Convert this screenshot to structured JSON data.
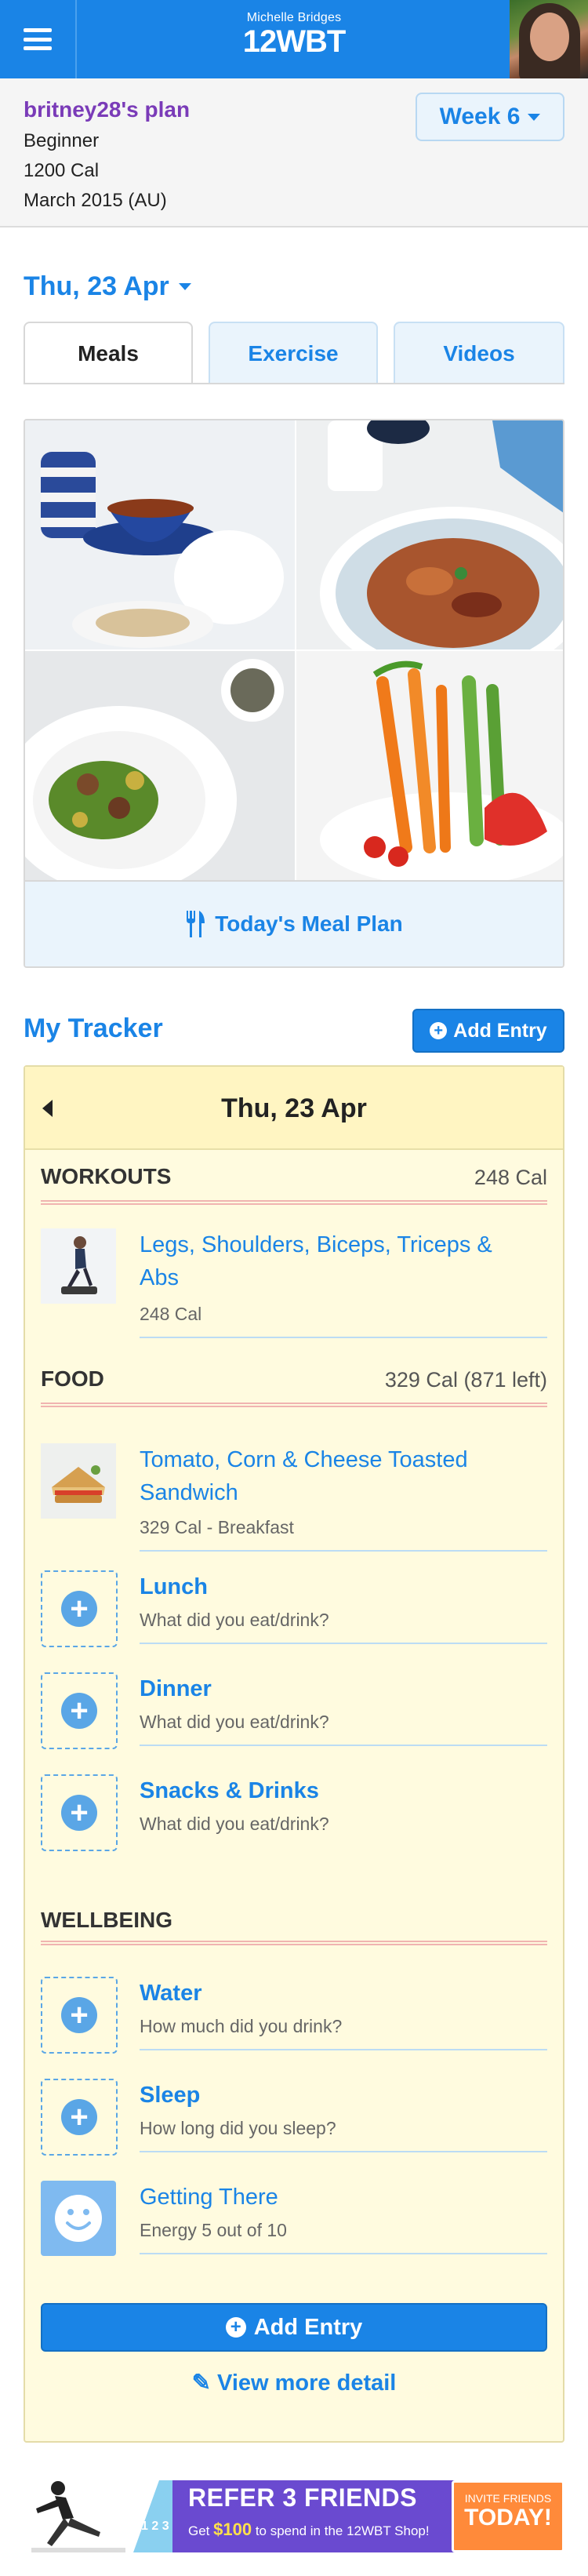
{
  "header": {
    "brand_sub": "Michelle Bridges",
    "brand_main": "12WBT"
  },
  "plan": {
    "name": "britney28's plan",
    "level": "Beginner",
    "calories": "1200 Cal",
    "round": "March 2015 (AU)",
    "week_label": "Week 6"
  },
  "date_selector": "Thu, 23 Apr",
  "tabs": [
    {
      "label": "Meals",
      "active": true
    },
    {
      "label": "Exercise",
      "active": false
    },
    {
      "label": "Videos",
      "active": false
    }
  ],
  "meal_plan_link": "Today's Meal Plan",
  "tracker": {
    "title": "My Tracker",
    "add_entry_label": "Add Entry",
    "date": "Thu, 23 Apr",
    "sections": {
      "workouts": {
        "title": "WORKOUTS",
        "total": "248 Cal",
        "items": [
          {
            "title": "Legs, Shoulders, Biceps, Triceps & Abs",
            "meta": "248 Cal"
          }
        ]
      },
      "food": {
        "title": "FOOD",
        "total": "329 Cal (871 left)",
        "items": [
          {
            "title": "Tomato, Corn & Cheese Toasted Sandwich",
            "meta": "329 Cal - Breakfast"
          },
          {
            "title": "Lunch",
            "meta": "What did you eat/drink?"
          },
          {
            "title": "Dinner",
            "meta": "What did you eat/drink?"
          },
          {
            "title": "Snacks & Drinks",
            "meta": "What did you eat/drink?"
          }
        ]
      },
      "wellbeing": {
        "title": "WELLBEING",
        "items": [
          {
            "title": "Water",
            "meta": "How much did you drink?"
          },
          {
            "title": "Sleep",
            "meta": "How long did you sleep?"
          },
          {
            "title": "Getting There",
            "meta": "Energy 5 out of 10"
          }
        ]
      }
    },
    "add_entry_big": "Add Entry",
    "view_more": "View more detail"
  },
  "banner": {
    "headline": "REFER 3 FRIENDS",
    "sub_prefix": "Get",
    "sub_amount": "$100",
    "sub_suffix": "to spend in the 12WBT Shop!",
    "steps": "1 2 3",
    "cta_small": "INVITE FRIENDS",
    "cta_big": "TODAY!"
  },
  "colors": {
    "primary": "#1a84e6",
    "plan_name": "#7a3bb8",
    "tracker_bg": "#fffbdf",
    "tracker_header": "#fff5c2"
  }
}
